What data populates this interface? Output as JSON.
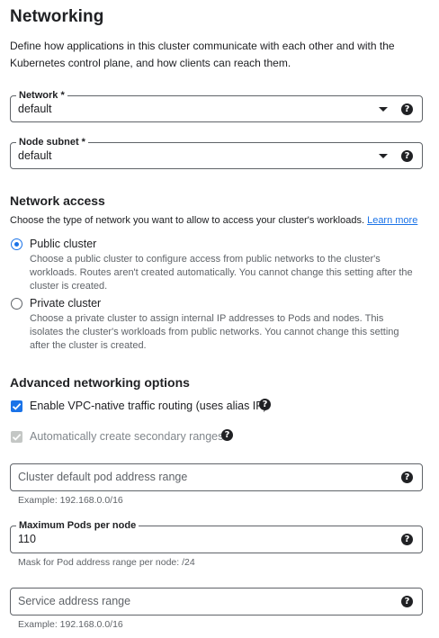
{
  "page": {
    "title": "Networking",
    "description": "Define how applications in this cluster communicate with each other and with the Kubernetes control plane, and how clients can reach them."
  },
  "network": {
    "label": "Network *",
    "value": "default"
  },
  "node_subnet": {
    "label": "Node subnet *",
    "value": "default"
  },
  "network_access": {
    "heading": "Network access",
    "description": "Choose the type of network you want to allow to access your cluster's workloads.",
    "learn_more": "Learn more",
    "options": [
      {
        "label": "Public cluster",
        "description": "Choose a public cluster to configure access from public networks to the cluster's workloads. Routes aren't created automatically. You cannot change this setting after the cluster is created.",
        "selected": true
      },
      {
        "label": "Private cluster",
        "description": "Choose a private cluster to assign internal IP addresses to Pods and nodes. This isolates the cluster's workloads from public networks. You cannot change this setting after the cluster is created.",
        "selected": false
      }
    ]
  },
  "advanced": {
    "heading": "Advanced networking options",
    "vpc_native": {
      "label": "Enable VPC-native traffic routing (uses alias IP)",
      "checked": true
    },
    "auto_secondary": {
      "label": "Automatically create secondary ranges",
      "checked": true,
      "disabled": true
    },
    "pod_range": {
      "placeholder": "Cluster default pod address range",
      "hint": "Example: 192.168.0.0/16"
    },
    "max_pods": {
      "label": "Maximum Pods per node",
      "value": "110",
      "hint": "Mask for Pod address range per node: /24"
    },
    "service_range": {
      "placeholder": "Service address range",
      "hint": "Example: 192.168.0.0/16"
    }
  },
  "icons": {
    "help": "?"
  },
  "colors": {
    "accent": "#1a73e8",
    "text": "#202124",
    "muted": "#5f6368"
  }
}
